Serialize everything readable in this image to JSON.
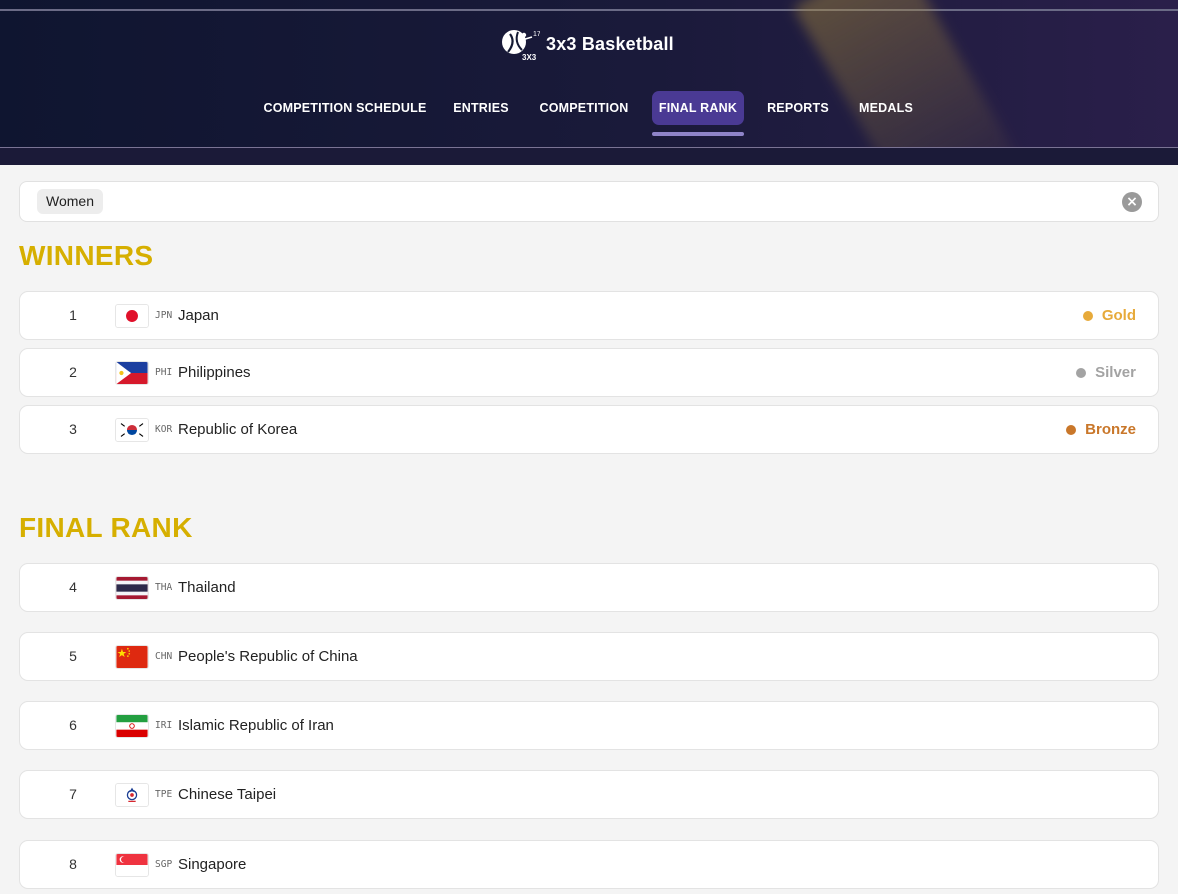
{
  "app": {
    "title": "3x3 Basketball",
    "logo_text": "3X3"
  },
  "nav": {
    "items": [
      {
        "label": "COMPETITION SCHEDULE"
      },
      {
        "label": "ENTRIES"
      },
      {
        "label": "COMPETITION"
      },
      {
        "label": "FINAL RANK"
      },
      {
        "label": "REPORTS"
      },
      {
        "label": "MEDALS"
      }
    ],
    "active": "FINAL RANK"
  },
  "filter": {
    "chip_label": "Women",
    "clear_icon": "close-circle-icon"
  },
  "winners": {
    "title": "WINNERS",
    "rows": [
      {
        "rank": "1",
        "code": "JPN",
        "name": "Japan",
        "flag": "japan-flag-icon",
        "medal": "Gold",
        "medal_color": "#e7aa3a"
      },
      {
        "rank": "2",
        "code": "PHI",
        "name": "Philippines",
        "flag": "philippines-flag-icon",
        "medal": "Silver",
        "medal_color": "#a3a3a3"
      },
      {
        "rank": "3",
        "code": "KOR",
        "name": "Republic of Korea",
        "flag": "korea-flag-icon",
        "medal": "Bronze",
        "medal_color": "#c9772a"
      }
    ]
  },
  "final_rank": {
    "title": "FINAL RANK",
    "rows": [
      {
        "rank": "4",
        "code": "THA",
        "name": "Thailand",
        "flag": "thailand-flag-icon"
      },
      {
        "rank": "5",
        "code": "CHN",
        "name": "People's Republic of China",
        "flag": "china-flag-icon"
      },
      {
        "rank": "6",
        "code": "IRI",
        "name": "Islamic Republic of Iran",
        "flag": "iran-flag-icon"
      },
      {
        "rank": "7",
        "code": "TPE",
        "name": "Chinese Taipei",
        "flag": "chinese-taipei-flag-icon"
      },
      {
        "rank": "8",
        "code": "SGP",
        "name": "Singapore",
        "flag": "singapore-flag-icon"
      }
    ]
  },
  "colors": {
    "header_bg": "#141a34",
    "active_tab": "#4a3a94",
    "section_title": "#d6af00"
  }
}
